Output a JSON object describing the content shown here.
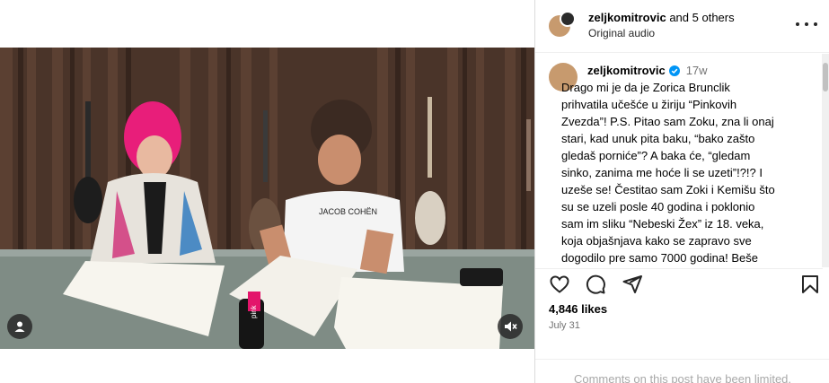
{
  "header": {
    "username": "zeljkomitrovic",
    "and_others": "and 5 others",
    "audio": "Original audio"
  },
  "caption": {
    "username": "zeljkomitrovic",
    "time": "17w",
    "lines": [
      "Drago mi je da je Zorica Brunclik",
      "prihvatila učešće u žiriju “Pinkovih",
      "Zvezda”! P.S. Pitao sam Zoku, zna li onaj",
      "stari, kad unuk pita baku, “bako zašto",
      "gledaš porniće”? A baka će, “gledam",
      "sinko,  zanima me hoće li se uzeti”!?!? I",
      "uzeše se! Čestitao sam Zoki i Kemišu što",
      "su se uzeli posle 40 godina i poklonio",
      "sam im sliku “Nebeski Žex” iz 18. veka,",
      "koja objašnjava kako se zapravo sve",
      "dogodilo pre samo 7000 godina! Beše"
    ]
  },
  "video": {
    "shirt_text": "JACOB COHËN",
    "mic_text": "pink"
  },
  "stats": {
    "likes": "4,846 likes",
    "date": "July 31"
  },
  "footer": {
    "limited": "Comments on this post have been limited."
  },
  "colors": {
    "verified": "#0095f6",
    "muted_text": "#737373"
  },
  "icons": [
    "user-tag-icon",
    "mute-icon",
    "more-icon",
    "heart-icon",
    "comment-icon",
    "share-icon",
    "bookmark-icon",
    "verified-icon"
  ]
}
